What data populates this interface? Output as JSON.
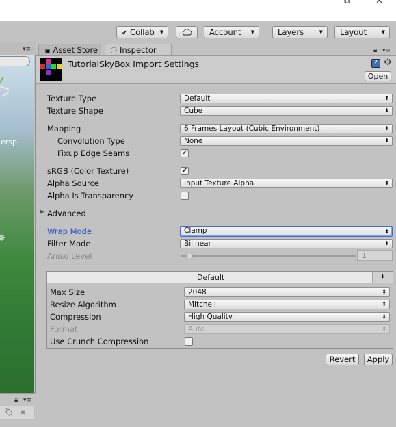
{
  "window": {
    "icons": {
      "popout": "popout-icon",
      "close": "close-icon"
    }
  },
  "toolbar": {
    "collab": "Collab",
    "cloud_icon": "cloud-icon",
    "account": "Account",
    "layers": "Layers",
    "layout": "Layout"
  },
  "scene": {
    "persp": "ersp"
  },
  "tabs": {
    "asset_store": "Asset Store",
    "inspector": "Inspector"
  },
  "header": {
    "title": "TutorialSkyBox Import Settings",
    "open": "Open"
  },
  "fields": {
    "texture_type": {
      "label": "Texture Type",
      "value": "Default"
    },
    "texture_shape": {
      "label": "Texture Shape",
      "value": "Cube"
    },
    "mapping": {
      "label": "Mapping",
      "value": "6 Frames Layout (Cubic Environment)"
    },
    "convolution_type": {
      "label": "Convolution Type",
      "value": "None"
    },
    "fixup_edge_seams": {
      "label": "Fixup Edge Seams",
      "checked": true
    },
    "srgb": {
      "label": "sRGB (Color Texture)",
      "checked": true
    },
    "alpha_source": {
      "label": "Alpha Source",
      "value": "Input Texture Alpha"
    },
    "alpha_is_transparency": {
      "label": "Alpha Is Transparency",
      "checked": false
    },
    "advanced": {
      "label": "Advanced"
    },
    "wrap_mode": {
      "label": "Wrap Mode",
      "value": "Clamp"
    },
    "filter_mode": {
      "label": "Filter Mode",
      "value": "Bilinear"
    },
    "aniso_level": {
      "label": "Aniso Level",
      "value": "1",
      "slider_fraction": 0.0
    }
  },
  "platform": {
    "tab": "Default",
    "max_size": {
      "label": "Max Size",
      "value": "2048"
    },
    "resize_algorithm": {
      "label": "Resize Algorithm",
      "value": "Mitchell"
    },
    "compression": {
      "label": "Compression",
      "value": "High Quality"
    },
    "format": {
      "label": "Format",
      "value": "Auto"
    },
    "use_crunch": {
      "label": "Use Crunch Compression",
      "checked": false
    }
  },
  "footer": {
    "revert": "Revert",
    "apply": "Apply"
  },
  "colors": {
    "panel": "#c2c2c2",
    "focus_label": "#2b4fc4",
    "focus_border": "#3d6fd6"
  }
}
